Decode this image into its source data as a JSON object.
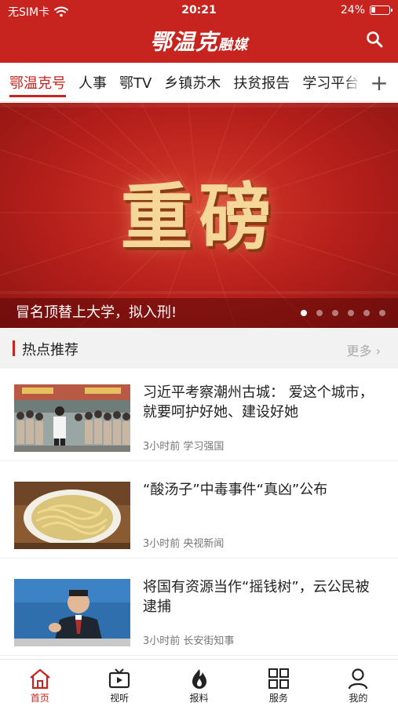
{
  "status": {
    "carrier": "无SIM卡",
    "time": "20:21",
    "battery": "24%",
    "battery_level": 0.24
  },
  "header": {
    "title_main": "鄂温克",
    "title_small": "融媒"
  },
  "tabs": {
    "items": [
      "鄂温克号",
      "人事",
      "鄂TV",
      "乡镇苏木",
      "扶贫报告",
      "学习平台"
    ],
    "active_index": 0,
    "more": "+"
  },
  "banner": {
    "title": "重磅",
    "caption": "冒名顶替上大学，拟入刑!",
    "slide_count": 6,
    "active_slide": 0
  },
  "section": {
    "title": "热点推荐",
    "more": "更多"
  },
  "news": [
    {
      "headline": "习近平考察潮州古城： 爱这个城市，就要呵护好她、建设好她",
      "time": "3小时前",
      "source": "学习强国"
    },
    {
      "headline": "“酸汤子”中毒事件“真凶”公布",
      "time": "3小时前",
      "source": "央视新闻"
    },
    {
      "headline": "将国有资源当作“摇钱树”，云公民被逮捕",
      "time": "3小时前",
      "source": "长安街知事"
    }
  ],
  "bottom_nav": [
    {
      "label": "首页",
      "icon": "home-icon",
      "active": true
    },
    {
      "label": "视听",
      "icon": "tv-icon",
      "active": false
    },
    {
      "label": "报料",
      "icon": "fire-icon",
      "active": false
    },
    {
      "label": "服务",
      "icon": "grid-icon",
      "active": false
    },
    {
      "label": "我的",
      "icon": "user-icon",
      "active": false
    }
  ],
  "colors": {
    "brand": "#c7241f",
    "banner_text": "#f6d79a"
  }
}
